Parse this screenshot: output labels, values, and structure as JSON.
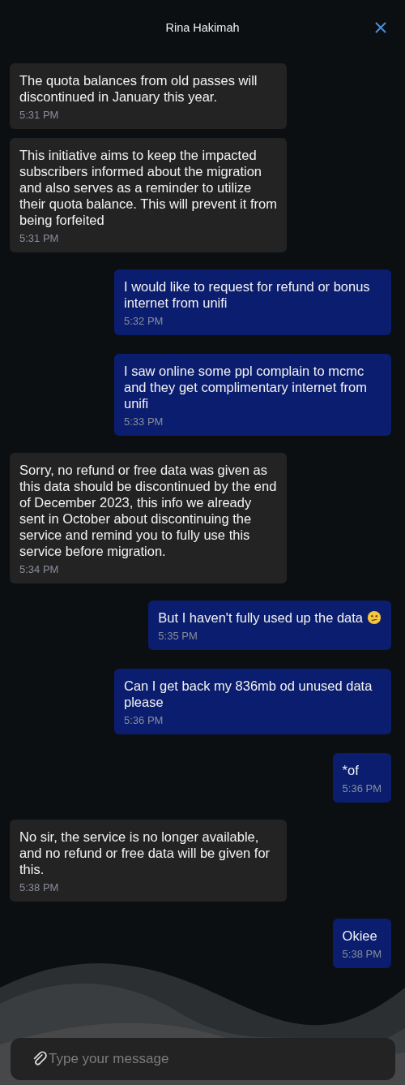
{
  "header": {
    "title": "Rina Hakimah"
  },
  "messages": [
    {
      "kind": "agent",
      "text": "The quota balances from old passes will discontinued in January this year.",
      "time": "5:31 PM"
    },
    {
      "kind": "agent",
      "text": "This initiative aims to keep the impacted subscribers informed about the migration and also serves as a reminder to utilize their quota balance. This will prevent it from being forfeited",
      "time": "5:31 PM"
    },
    {
      "kind": "user",
      "text": "I would like to request for refund or bonus internet from unifi",
      "time": "5:32 PM"
    },
    {
      "kind": "user",
      "text": "I saw online some ppl complain to mcmc and they get complimentary internet from unifi",
      "time": "5:33 PM"
    },
    {
      "kind": "agent",
      "text": "Sorry, no refund or free data was given as this data should be discontinued by the end of December 2023, this info we already sent in October about discontinuing the service and remind you to fully use this service before migration.",
      "time": "5:34 PM"
    },
    {
      "kind": "user",
      "text": "But I haven't fully used up the data",
      "confused_emoji": true,
      "time": "5:35 PM"
    },
    {
      "kind": "user",
      "text": "Can I get back my 836mb od unused data please",
      "time": "5:36 PM"
    },
    {
      "kind": "user",
      "text": "*of",
      "time": "5:36 PM"
    },
    {
      "kind": "agent",
      "text": "No sir, the service is no longer available, and no refund or free data will be given for this.",
      "time": "5:38 PM"
    },
    {
      "kind": "user",
      "text": "Okiee",
      "time": "5:38 PM"
    }
  ],
  "composer": {
    "placeholder": "Type your message"
  }
}
